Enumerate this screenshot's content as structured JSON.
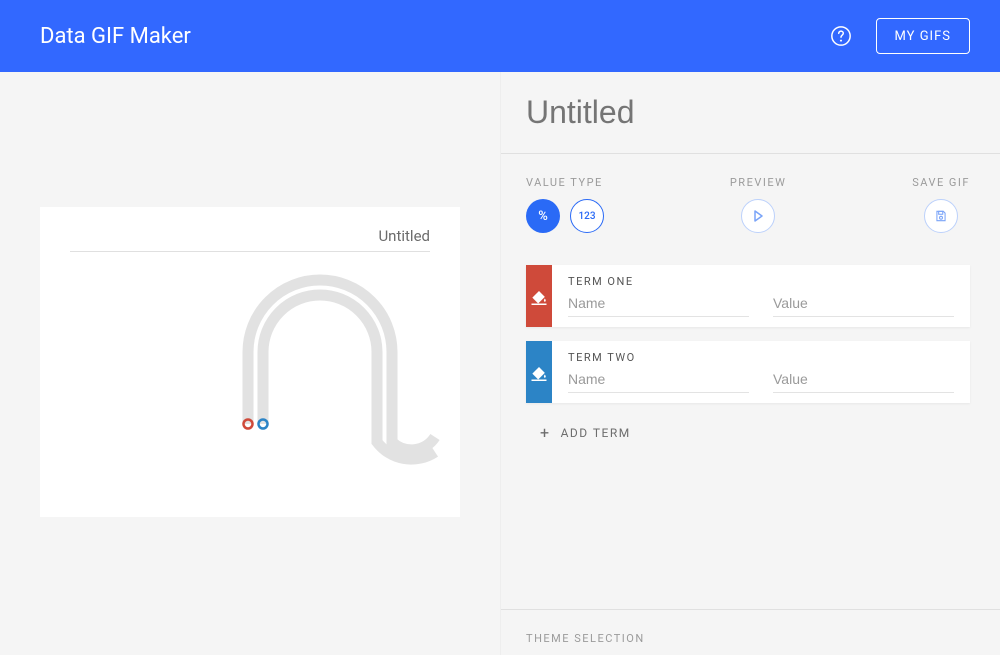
{
  "header": {
    "app_title": "Data GIF Maker",
    "my_gifs_label": "MY GIFS"
  },
  "title": {
    "placeholder": "Untitled",
    "value": ""
  },
  "preview": {
    "title_display": "Untitled"
  },
  "toolbar": {
    "value_type_label": "VALUE TYPE",
    "percent_label": "%",
    "number_label": "123",
    "preview_label": "PREVIEW",
    "save_label": "SAVE GIF"
  },
  "terms": [
    {
      "label": "TERM ONE",
      "name_placeholder": "Name",
      "value_placeholder": "Value",
      "color": "#cf4a3a"
    },
    {
      "label": "TERM TWO",
      "name_placeholder": "Name",
      "value_placeholder": "Value",
      "color": "#2c84c6"
    }
  ],
  "add_term_label": "ADD TERM",
  "theme_label": "THEME SELECTION"
}
